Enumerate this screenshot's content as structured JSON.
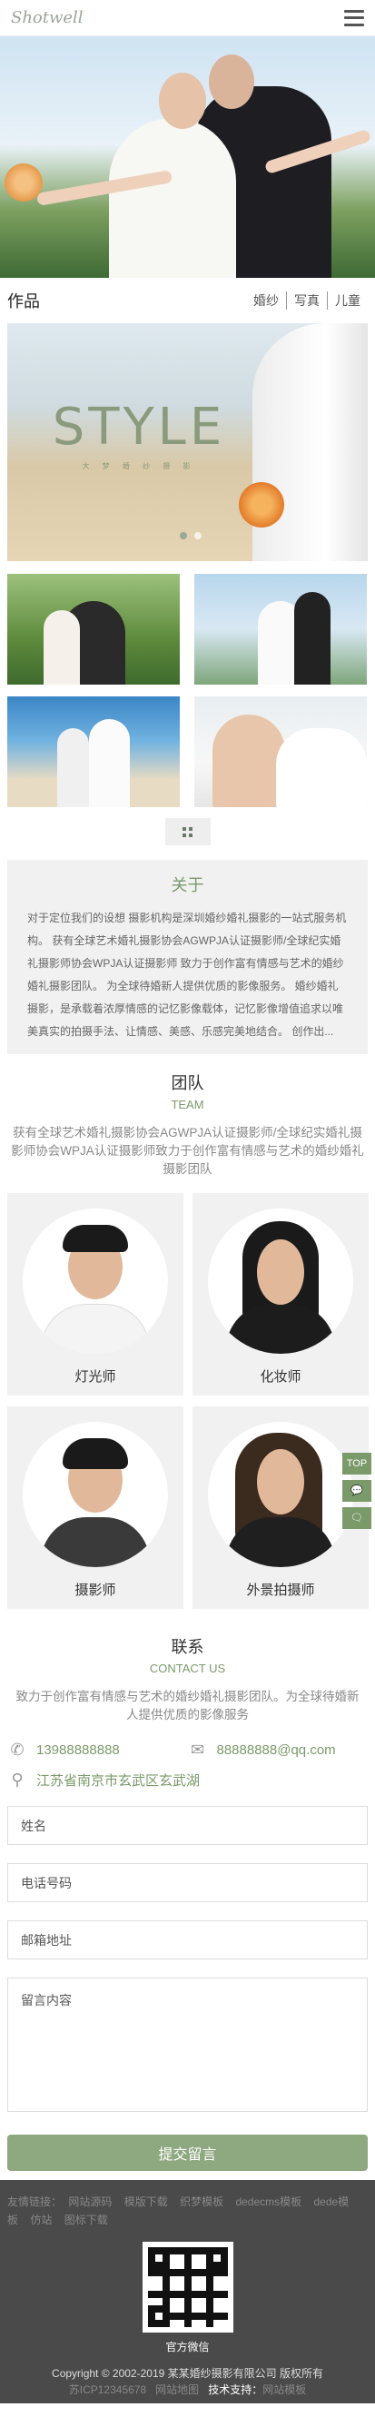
{
  "header": {
    "logo": "Shotwell",
    "menu_icon": "hamburger-menu-icon"
  },
  "works": {
    "title": "作品",
    "categories": [
      "婚纱",
      "写真",
      "儿童"
    ],
    "banner_title": "STYLE",
    "banner_sub": "大 梦 婚 纱 摄 影"
  },
  "about": {
    "title": "关于",
    "text": "对于定位我们的设想 摄影机构是深圳婚纱婚礼摄影的一站式服务机构。 获有全球艺术婚礼摄影协会AGWPJA认证摄影师/全球纪实婚礼摄影师协会WPJA认证摄影师 致力于创作富有情感与艺术的婚纱婚礼摄影团队。 为全球待婚新人提供优质的影像服务。 婚纱婚礼摄影，是承载着浓厚情感的记忆影像载体，记忆影像增值追求以唯美真实的拍摄手法、让情感、美感、乐感完美地结合。 创作出..."
  },
  "team": {
    "title": "团队",
    "en": "TEAM",
    "desc": "获有全球艺术婚礼摄影协会AGWPJA认证摄影师/全球纪实婚礼摄影师协会WPJA认证摄影师致力于创作富有情感与艺术的婚纱婚礼摄影团队",
    "members": [
      {
        "role": "灯光师"
      },
      {
        "role": "化妆师"
      },
      {
        "role": "摄影师"
      },
      {
        "role": "外景拍摄师"
      }
    ]
  },
  "float": {
    "top": "TOP"
  },
  "contact": {
    "title": "联系",
    "en": "CONTACT US",
    "desc": "致力于创作富有情感与艺术的婚纱婚礼摄影团队。为全球待婚新人提供优质的影像服务",
    "phone": "13988888888",
    "email": "88888888@qq.com",
    "address": "江苏省南京市玄武区玄武湖",
    "form": {
      "name_placeholder": "姓名",
      "phone_placeholder": "电话号码",
      "email_placeholder": "邮箱地址",
      "message_placeholder": "留言内容",
      "submit": "提交留言"
    }
  },
  "footer": {
    "links_label": "友情链接：",
    "links": [
      "网站源码",
      "模版下载",
      "织梦模板",
      "dedecms模板",
      "dede模板",
      "仿站",
      "图标下载"
    ],
    "qr_label": "官方微信",
    "copyright": "Copyright © 2002-2019 某某婚纱摄影有限公司 版权所有",
    "icp": "苏ICP12345678",
    "sitemap": "网站地图",
    "support_label": "技术支持：",
    "support": "网站模板"
  },
  "colors": {
    "accent": "#7a9a6a",
    "button": "#8ea880",
    "footer": "#4a4a4a"
  }
}
